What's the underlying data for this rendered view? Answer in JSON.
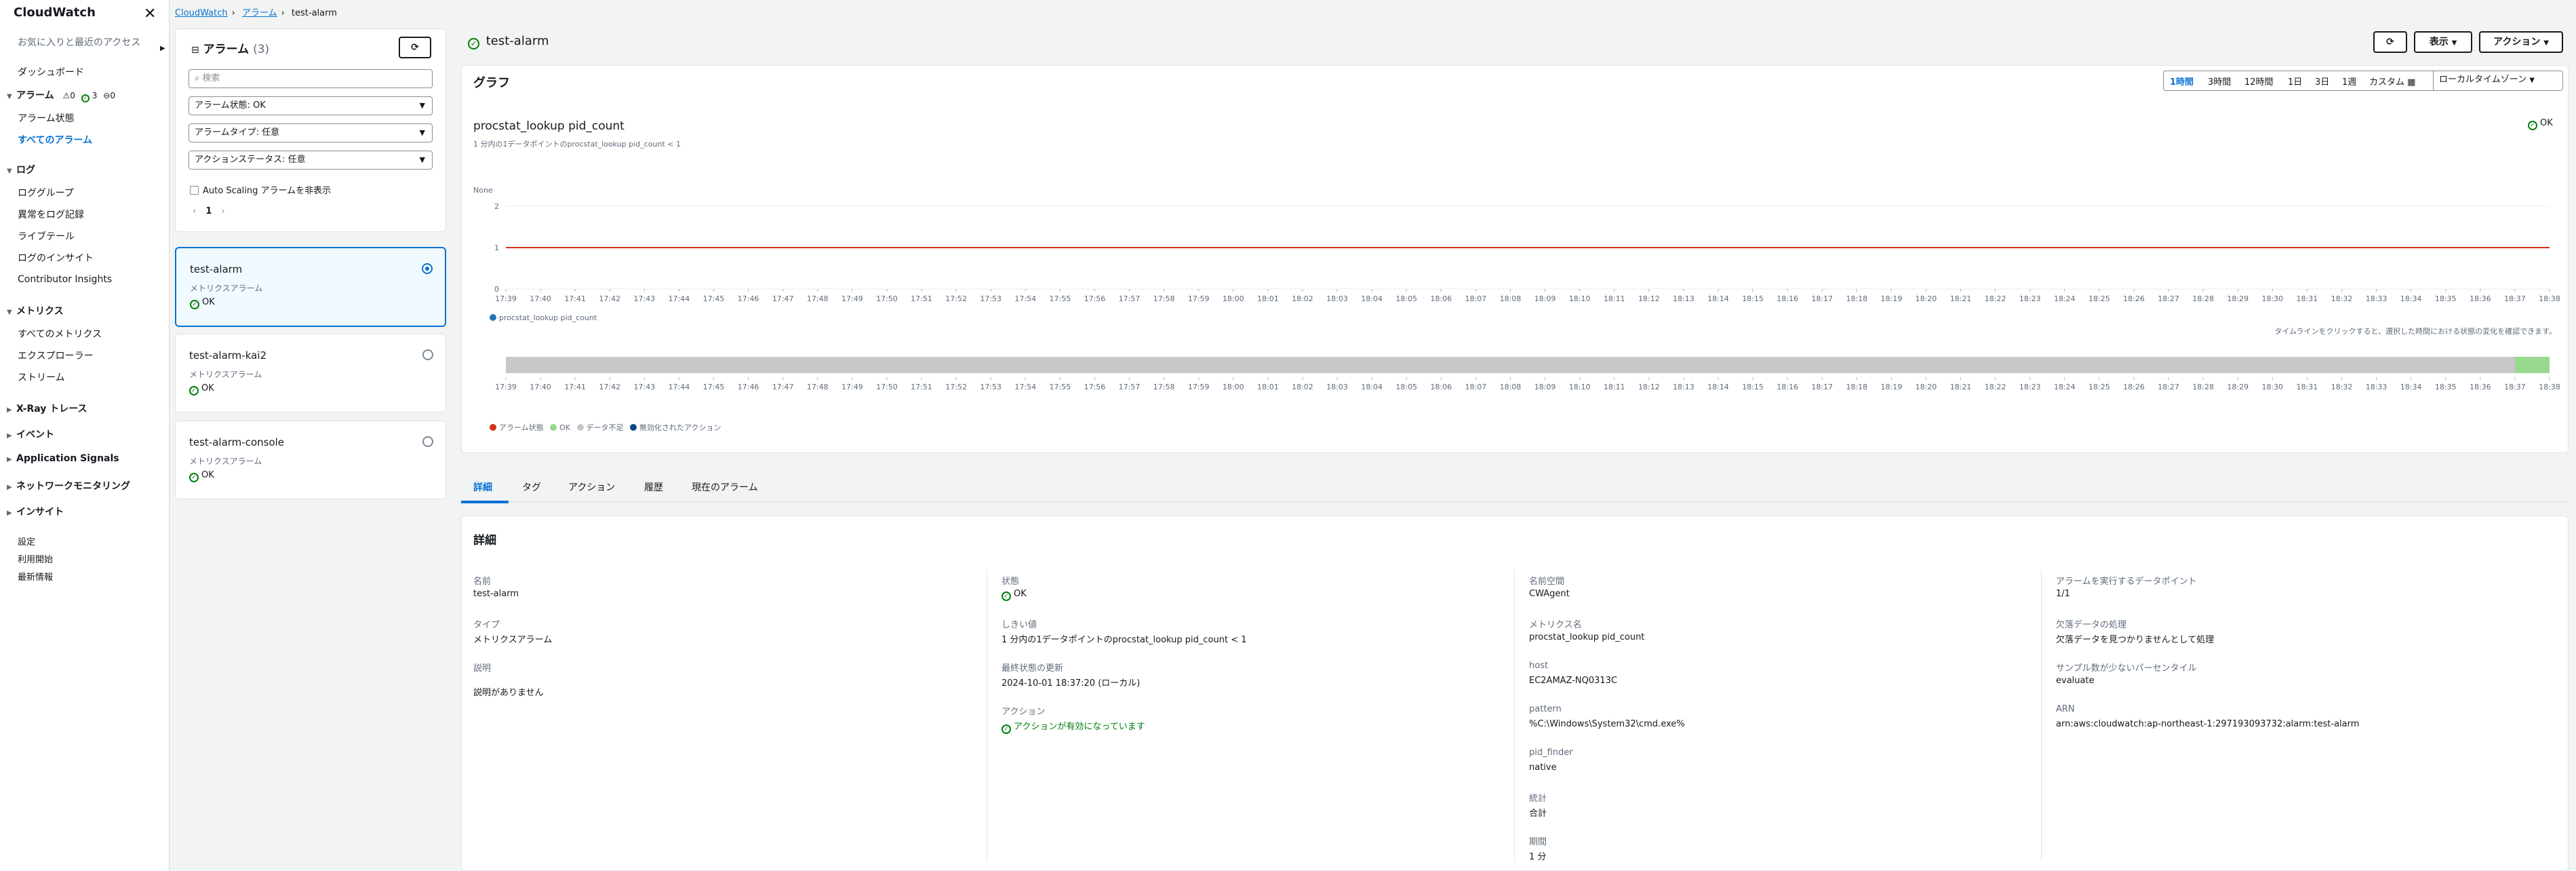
{
  "sidebar": {
    "title": "CloudWatch",
    "favorites": "お気に入りと最近のアクセス",
    "dashboard": "ダッシュボード",
    "alarms_section": "アラーム",
    "alarm_counts": {
      "alarm": "0",
      "ok": "3",
      "insufficient": "0"
    },
    "alarm_items": [
      "アラーム状態",
      "すべてのアラーム"
    ],
    "logs_section": "ログ",
    "log_items": [
      "ロググループ",
      "異常をログ記録",
      "ライブテール",
      "ログのインサイト",
      "Contributor Insights"
    ],
    "metrics_section": "メトリクス",
    "metric_items": [
      "すべてのメトリクス",
      "エクスプローラー",
      "ストリーム"
    ],
    "collapsed_sections": [
      "X-Ray トレース",
      "イベント",
      "Application Signals",
      "ネットワークモニタリング",
      "インサイト"
    ],
    "footer_items": [
      "設定",
      "利用開始",
      "最新情報"
    ]
  },
  "breadcrumb": [
    "CloudWatch",
    "アラーム",
    "test-alarm"
  ],
  "list": {
    "title": "アラーム",
    "count": "(3)",
    "search_placeholder": "検索",
    "filters": [
      "アラーム状態: OK",
      "アラームタイプ: 任意",
      "アクションステータス: 任意"
    ],
    "checkbox_label": "Auto Scaling アラームを非表示",
    "page": "1",
    "alarms": [
      {
        "name": "test-alarm",
        "type": "メトリクスアラーム",
        "state": "OK"
      },
      {
        "name": "test-alarm-kai2",
        "type": "メトリクスアラーム",
        "state": "OK"
      },
      {
        "name": "test-alarm-console",
        "type": "メトリクスアラーム",
        "state": "OK"
      }
    ]
  },
  "header": {
    "alarm_name": "test-alarm",
    "view_button": "表示",
    "actions_button": "アクション"
  },
  "graph": {
    "title": "グラフ",
    "ranges": [
      "1時間",
      "3時間",
      "12時間",
      "1日",
      "3日",
      "1週",
      "カスタム"
    ],
    "timezone": "ローカルタイムゾーン",
    "metric_title": "procstat_lookup pid_count",
    "metric_subtitle": "1 分内の1データポイントのprocstat_lookup pid_count < 1",
    "status": "OK",
    "y_unit": "None",
    "legend_series": "procstat_lookup pid_count",
    "timeline_hint": "タイムラインをクリックすると、選択した時間における状態の変化を確認できます。",
    "state_legend": [
      "アラーム状態",
      "OK",
      "データ不足",
      "無効化されたアクション"
    ],
    "colors": {
      "threshold": "#d13212",
      "series": "#1f77b4",
      "ok": "#98d88e",
      "insufficient": "#c8c8c8",
      "alarm": "#d13212",
      "disabled": "#0a4a85"
    }
  },
  "chart_data": {
    "type": "line",
    "x": [
      "17:39",
      "17:40",
      "17:41",
      "17:42",
      "17:43",
      "17:44",
      "17:45",
      "17:46",
      "17:47",
      "17:48",
      "17:49",
      "17:50",
      "17:51",
      "17:52",
      "17:53",
      "17:54",
      "17:55",
      "17:56",
      "17:57",
      "17:58",
      "17:59",
      "18:00",
      "18:01",
      "18:02",
      "18:03",
      "18:04",
      "18:05",
      "18:06",
      "18:07",
      "18:08",
      "18:09",
      "18:10",
      "18:11",
      "18:12",
      "18:13",
      "18:14",
      "18:15",
      "18:16",
      "18:17",
      "18:18",
      "18:19",
      "18:20",
      "18:21",
      "18:22",
      "18:23",
      "18:24",
      "18:25",
      "18:26",
      "18:27",
      "18:28",
      "18:29",
      "18:30",
      "18:31",
      "18:32",
      "18:33",
      "18:34",
      "18:35",
      "18:36",
      "18:37",
      "18:38"
    ],
    "yticks": [
      0,
      1,
      2
    ],
    "ylim": [
      0,
      2
    ],
    "threshold": 1,
    "series": [
      {
        "name": "procstat_lookup pid_count",
        "values": []
      }
    ],
    "timeline": {
      "insufficient_until": "18:37",
      "ok_from": "18:37"
    }
  },
  "tabs": [
    "詳細",
    "タグ",
    "アクション",
    "履歴",
    "現在のアラーム"
  ],
  "details": {
    "title": "詳細",
    "col1": [
      {
        "label": "名前",
        "value": "test-alarm"
      },
      {
        "label": "タイプ",
        "value": "メトリクスアラーム"
      },
      {
        "label": "説明",
        "value": "説明がありません"
      }
    ],
    "col2": [
      {
        "label": "状態",
        "value": "OK"
      },
      {
        "label": "しきい値",
        "value": "1 分内の1データポイントのprocstat_lookup pid_count < 1"
      },
      {
        "label": "最終状態の更新",
        "value": "2024-10-01 18:37:20 (ローカル)"
      },
      {
        "label": "アクション",
        "value": "アクションが有効になっています"
      }
    ],
    "col3": [
      {
        "label": "名前空間",
        "value": "CWAgent"
      },
      {
        "label": "メトリクス名",
        "value": "procstat_lookup pid_count"
      },
      {
        "label": "host",
        "value": "EC2AMAZ-NQ0313C"
      },
      {
        "label": "pattern",
        "value": "%C:\\Windows\\System32\\cmd.exe%"
      },
      {
        "label": "pid_finder",
        "value": "native"
      },
      {
        "label": "統計",
        "value": "合計"
      },
      {
        "label": "期間",
        "value": "1 分"
      }
    ],
    "col4": [
      {
        "label": "アラームを実行するデータポイント",
        "value": "1/1"
      },
      {
        "label": "欠落データの処理",
        "value": "欠落データを見つかりませんとして処理"
      },
      {
        "label": "サンプル数が少ないパーセンタイル",
        "value": "evaluate"
      },
      {
        "label": "ARN",
        "value": "arn:aws:cloudwatch:ap-northeast-1:297193093732:alarm:test-alarm"
      }
    ]
  }
}
